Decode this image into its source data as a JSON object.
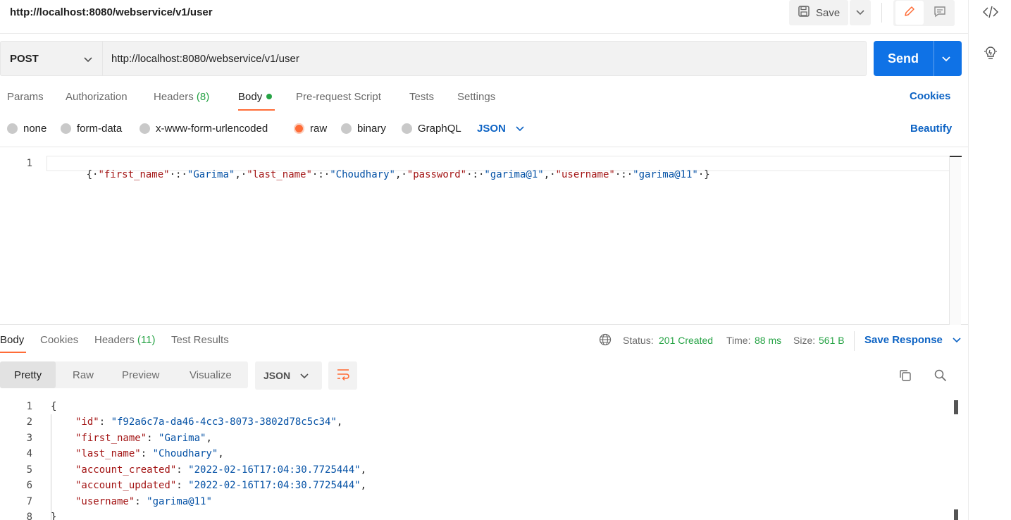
{
  "window": {
    "title": "http://localhost:8080/webservice/v1/user"
  },
  "toolbar": {
    "save_label": "Save"
  },
  "request": {
    "method": "POST",
    "url": "http://localhost:8080/webservice/v1/user",
    "send_label": "Send"
  },
  "request_tabs": {
    "params": "Params",
    "authorization": "Authorization",
    "headers": "Headers",
    "headers_count": "(8)",
    "body": "Body",
    "prerequest": "Pre-request Script",
    "tests": "Tests",
    "settings": "Settings",
    "cookies": "Cookies"
  },
  "body_types": {
    "none": "none",
    "form_data": "form-data",
    "urlencoded": "x-www-form-urlencoded",
    "raw": "raw",
    "binary": "binary",
    "graphql": "GraphQL",
    "selected": "raw",
    "format": "JSON",
    "beautify": "Beautify"
  },
  "request_body": {
    "line_number": "1",
    "open": "{",
    "k1": "\"first_name\"",
    "v1": "\"Garima\"",
    "k2": "\"last_name\"",
    "v2": "\"Choudhary\"",
    "k3": "\"password\"",
    "v3": "\"garima@1\"",
    "k4": "\"username\"",
    "v4": "\"garima@11\"",
    "close": "}"
  },
  "response_tabs": {
    "body": "Body",
    "cookies": "Cookies",
    "headers": "Headers",
    "headers_count": "(11)",
    "test_results": "Test Results"
  },
  "response_meta": {
    "status_label": "Status:",
    "status_value": "201 Created",
    "time_label": "Time:",
    "time_value": "88 ms",
    "size_label": "Size:",
    "size_value": "561 B",
    "save_response": "Save Response"
  },
  "response_view": {
    "pretty": "Pretty",
    "raw": "Raw",
    "preview": "Preview",
    "visualize": "Visualize",
    "format": "JSON"
  },
  "response_body": {
    "lines": [
      {
        "n": "1",
        "text": "{"
      },
      {
        "n": "2",
        "key": "\"id\"",
        "value": "\"f92a6c7a-da46-4cc3-8073-3802d78c5c34\"",
        "tail": ","
      },
      {
        "n": "3",
        "key": "\"first_name\"",
        "value": "\"Garima\"",
        "tail": ","
      },
      {
        "n": "4",
        "key": "\"last_name\"",
        "value": "\"Choudhary\"",
        "tail": ","
      },
      {
        "n": "5",
        "key": "\"account_created\"",
        "value": "\"2022-02-16T17:04:30.7725444\"",
        "tail": ","
      },
      {
        "n": "6",
        "key": "\"account_updated\"",
        "value": "\"2022-02-16T17:04:30.7725444\"",
        "tail": ","
      },
      {
        "n": "7",
        "key": "\"username\"",
        "value": "\"garima@11\"",
        "tail": ""
      },
      {
        "n": "8",
        "text": "}"
      }
    ]
  },
  "colors": {
    "accent": "#ff6c37",
    "send": "#0f72e6",
    "link": "#0d63c4",
    "success": "#26a345",
    "json_key": "#a31515",
    "json_string": "#0451a5"
  },
  "icons": {
    "save": "floppy-disk-icon",
    "edit": "pencil-icon",
    "comment": "comment-icon",
    "code": "code-icon",
    "bulb": "lightbulb-icon",
    "globe": "globe-icon",
    "wrap": "wrap-lines-icon",
    "copy": "copy-icon",
    "search": "search-icon"
  }
}
